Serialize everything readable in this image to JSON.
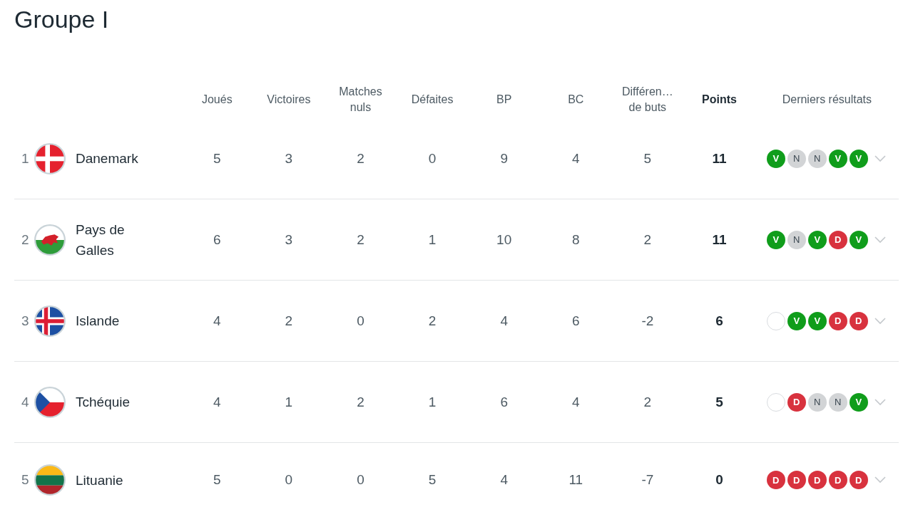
{
  "title": "Groupe I",
  "columns": [
    "Joués",
    "Victoires",
    "Matches nuls",
    "Défaites",
    "BP",
    "BC",
    "Différen… de buts",
    "Points",
    "Derniers résultats"
  ],
  "rows": [
    {
      "rank": "1",
      "kind": "dk",
      "team": "Danemark",
      "stats": [
        "5",
        "3",
        "2",
        "0",
        "9",
        "4",
        "5"
      ],
      "points": "11",
      "form": [
        {
          "kind": "win",
          "label": "V"
        },
        {
          "kind": "draw",
          "label": "N"
        },
        {
          "kind": "draw",
          "label": "N"
        },
        {
          "kind": "win",
          "label": "V"
        },
        {
          "kind": "win",
          "label": "V"
        }
      ]
    },
    {
      "rank": "2",
      "kind": "wales",
      "team": "Pays de Galles",
      "stats": [
        "6",
        "3",
        "2",
        "1",
        "10",
        "8",
        "2"
      ],
      "points": "11",
      "form": [
        {
          "kind": "win",
          "label": "V"
        },
        {
          "kind": "draw",
          "label": "N"
        },
        {
          "kind": "win",
          "label": "V"
        },
        {
          "kind": "loss",
          "label": "D"
        },
        {
          "kind": "win",
          "label": "V"
        }
      ]
    },
    {
      "rank": "3",
      "kind": "is",
      "team": "Islande",
      "stats": [
        "4",
        "2",
        "0",
        "2",
        "4",
        "6",
        "-2"
      ],
      "points": "6",
      "form": [
        {
          "kind": "empty"
        },
        {
          "kind": "win",
          "label": "V"
        },
        {
          "kind": "win",
          "label": "V"
        },
        {
          "kind": "loss",
          "label": "D"
        },
        {
          "kind": "loss",
          "label": "D"
        }
      ]
    },
    {
      "rank": "4",
      "kind": "cz",
      "team": "Tchéquie",
      "stats": [
        "4",
        "1",
        "2",
        "1",
        "6",
        "4",
        "2"
      ],
      "points": "5",
      "form": [
        {
          "kind": "empty"
        },
        {
          "kind": "loss",
          "label": "D"
        },
        {
          "kind": "draw",
          "label": "N"
        },
        {
          "kind": "draw",
          "label": "N"
        },
        {
          "kind": "win",
          "label": "V"
        }
      ]
    },
    {
      "rank": "5",
      "kind": "lt",
      "team": "Lituanie",
      "stats": [
        "5",
        "0",
        "0",
        "5",
        "4",
        "11",
        "-7"
      ],
      "points": "0",
      "form": [
        {
          "kind": "loss",
          "label": "D"
        },
        {
          "kind": "loss",
          "label": "D"
        },
        {
          "kind": "loss",
          "label": "D"
        },
        {
          "kind": "loss",
          "label": "D"
        },
        {
          "kind": "loss",
          "label": "D"
        }
      ]
    }
  ]
}
